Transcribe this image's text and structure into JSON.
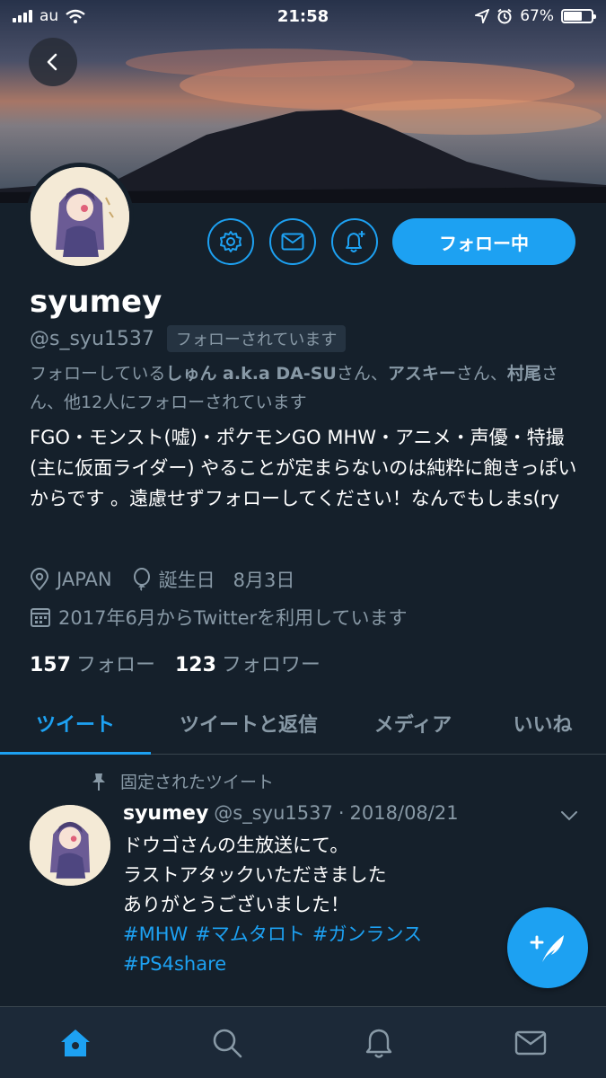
{
  "status_bar": {
    "carrier": "au",
    "time": "21:58",
    "battery": "67%",
    "battery_level": 0.67
  },
  "profile": {
    "name": "syumey",
    "handle": "@s_syu1537",
    "follows_you": "フォローされています",
    "followed_by": {
      "prefix": "フォローしている",
      "user1": "しゅん a.k.a DA-SU",
      "sep1": "さん、",
      "user2": "アスキー",
      "sep2": "さん、",
      "user3": "村尾",
      "suffix": "さん、他12人にフォローされています"
    },
    "bio": "FGO・モンスト(嘘)・ポケモンGO MHW・アニメ・声優・特撮(主に仮面ライダー) やることが定まらないのは純粋に飽きっぽいからです 。遠慮せずフォローしてください！なんでもしまs(ry",
    "location": "JAPAN",
    "birthday_label": "誕生日",
    "birthday": "8月3日",
    "joined": "2017年6月からTwitterを利用しています",
    "following_count": "157",
    "following_label": "フォロー",
    "followers_count": "123",
    "followers_label": "フォロワー",
    "follow_button": "フォロー中"
  },
  "tabs": [
    {
      "label": "ツイート",
      "active": true
    },
    {
      "label": "ツイートと返信",
      "active": false
    },
    {
      "label": "メディア",
      "active": false
    },
    {
      "label": "いいね",
      "active": false
    }
  ],
  "tweet": {
    "pinned_label": "固定されたツイート",
    "name": "syumey",
    "handle": "@s_syu1537",
    "dot": "·",
    "date": "2018/08/21",
    "lines": [
      "ドウゴさんの生放送にて。",
      "ラストアタックいただきました",
      "ありがとうございました！"
    ],
    "hashtags": [
      "#MHW",
      "#マムタロト",
      "#ガンランス",
      "#PS4share"
    ]
  },
  "colors": {
    "background": "#15202b",
    "accent": "#1da1f2",
    "secondary_text": "#8899a6",
    "nav_bg": "#1c2938"
  },
  "icons": {
    "back": "chevron-left-icon",
    "settings": "gear-icon",
    "message": "envelope-icon",
    "notify": "bell-plus-icon",
    "location": "location-pin-icon",
    "birthday": "balloon-icon",
    "joined": "calendar-icon",
    "pinned": "pin-icon",
    "more": "chevron-down-icon",
    "compose": "feather-plus-icon",
    "nav": [
      "home-icon",
      "search-icon",
      "bell-icon",
      "envelope-icon"
    ]
  }
}
